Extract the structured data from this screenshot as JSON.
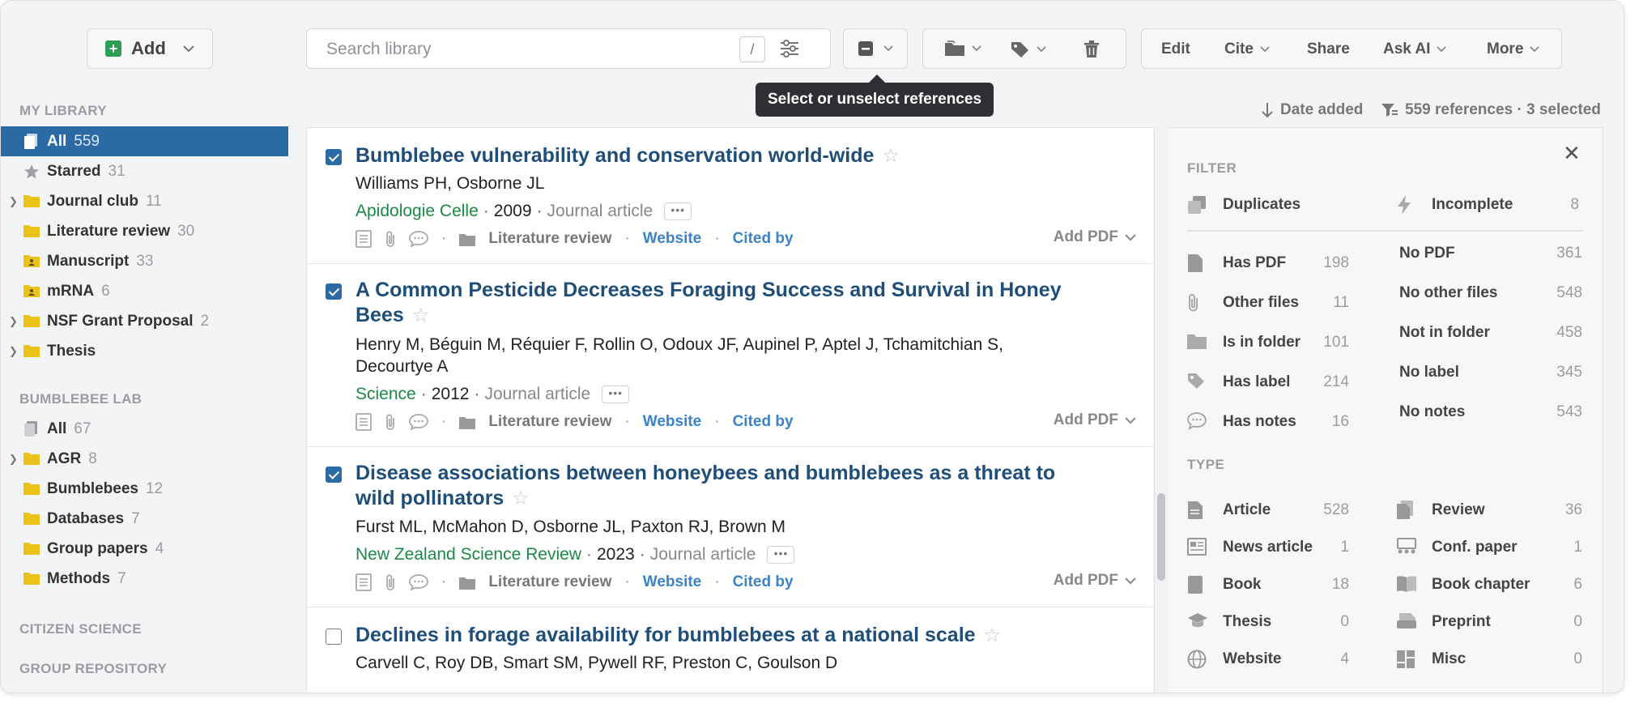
{
  "toolbar": {
    "add_label": "Add",
    "search_placeholder": "Search library",
    "search_shortcut": "/",
    "actions": {
      "edit": "Edit",
      "cite": "Cite",
      "share": "Share",
      "ask_ai": "Ask AI",
      "more": "More"
    }
  },
  "tooltip": "Select or unselect references",
  "sort": {
    "label": "Date added",
    "summary": "559 references · 3 selected"
  },
  "sidebar": {
    "my_library": {
      "heading": "MY LIBRARY",
      "items": [
        {
          "label": "All",
          "count": "559"
        },
        {
          "label": "Starred",
          "count": "31"
        },
        {
          "label": "Journal club",
          "count": "11"
        },
        {
          "label": "Literature review",
          "count": "30"
        },
        {
          "label": "Manuscript",
          "count": "33"
        },
        {
          "label": "mRNA",
          "count": "6"
        },
        {
          "label": "NSF Grant Proposal",
          "count": "2"
        },
        {
          "label": "Thesis",
          "count": ""
        }
      ]
    },
    "bumblebee_lab": {
      "heading": "BUMBLEBEE LAB",
      "items": [
        {
          "label": "All",
          "count": "67"
        },
        {
          "label": "AGR",
          "count": "8"
        },
        {
          "label": "Bumblebees",
          "count": "12"
        },
        {
          "label": "Databases",
          "count": "7"
        },
        {
          "label": "Group papers",
          "count": "4"
        },
        {
          "label": "Methods",
          "count": "7"
        }
      ]
    },
    "citizen_science": "CITIZEN SCIENCE",
    "group_repository": "GROUP REPOSITORY"
  },
  "references": [
    {
      "title": "Bumblebee vulnerability and conservation world-wide",
      "authors": "Williams PH, Osborne JL",
      "journal": "Apidologie Celle",
      "year": "2009",
      "type": "Journal article",
      "folder": "Literature review",
      "website": "Website",
      "cited_by": "Cited by",
      "add_pdf": "Add PDF",
      "selected": true
    },
    {
      "title": "A Common Pesticide Decreases Foraging Success and Survival in Honey Bees",
      "authors": "Henry M, Béguin M, Réquier F, Rollin O, Odoux JF, Aupinel P, Aptel J, Tchamitchian S, Decourtye A",
      "journal": "Science",
      "year": "2012",
      "type": "Journal article",
      "folder": "Literature review",
      "website": "Website",
      "cited_by": "Cited by",
      "add_pdf": "Add PDF",
      "selected": true
    },
    {
      "title": "Disease associations between honeybees and bumblebees as a threat to wild pollinators",
      "authors": "Furst ML, McMahon D, Osborne JL, Paxton RJ, Brown M",
      "journal": "New Zealand Science Review",
      "year": "2023",
      "type": "Journal article",
      "folder": "Literature review",
      "website": "Website",
      "cited_by": "Cited by",
      "add_pdf": "Add PDF",
      "selected": true
    },
    {
      "title": "Declines in forage availability for bumblebees at a national scale",
      "authors": "Carvell C, Roy DB, Smart SM, Pywell RF, Preston C, Goulson D",
      "selected": false
    }
  ],
  "filter": {
    "heading": "FILTER",
    "quick": [
      {
        "label": "Duplicates",
        "count": "",
        "icon": "duplicates-icon"
      },
      {
        "label": "Incomplete",
        "count": "8",
        "icon": "lightning-icon"
      }
    ],
    "attributes": [
      {
        "has": "Has PDF",
        "has_count": "198",
        "not": "No PDF",
        "not_count": "361",
        "icon": "pdf-icon"
      },
      {
        "has": "Other files",
        "has_count": "11",
        "not": "No other files",
        "not_count": "548",
        "icon": "paperclip-icon"
      },
      {
        "has": "Is in folder",
        "has_count": "101",
        "not": "Not in folder",
        "not_count": "458",
        "icon": "folder-icon"
      },
      {
        "has": "Has label",
        "has_count": "214",
        "not": "No label",
        "not_count": "345",
        "icon": "label-icon"
      },
      {
        "has": "Has notes",
        "has_count": "16",
        "not": "No notes",
        "not_count": "543",
        "icon": "notes-icon"
      }
    ],
    "type_heading": "TYPE",
    "types": [
      {
        "label": "Article",
        "count": "528",
        "icon": "article-icon"
      },
      {
        "label": "Review",
        "count": "36",
        "icon": "review-icon"
      },
      {
        "label": "News article",
        "count": "1",
        "icon": "news-icon"
      },
      {
        "label": "Conf. paper",
        "count": "1",
        "icon": "conference-icon"
      },
      {
        "label": "Book",
        "count": "18",
        "icon": "book-icon"
      },
      {
        "label": "Book chapter",
        "count": "6",
        "icon": "book-chapter-icon"
      },
      {
        "label": "Thesis",
        "count": "0",
        "icon": "graduation-cap-icon"
      },
      {
        "label": "Preprint",
        "count": "0",
        "icon": "preprint-icon"
      },
      {
        "label": "Website",
        "count": "4",
        "icon": "globe-icon"
      },
      {
        "label": "Misc",
        "count": "0",
        "icon": "misc-icon"
      }
    ]
  },
  "colors": {
    "accent": "#2c6aa5",
    "title": "#1f4e79",
    "journal": "#1a8a45",
    "link": "#3a83c8",
    "add_green": "#2e9e57"
  }
}
